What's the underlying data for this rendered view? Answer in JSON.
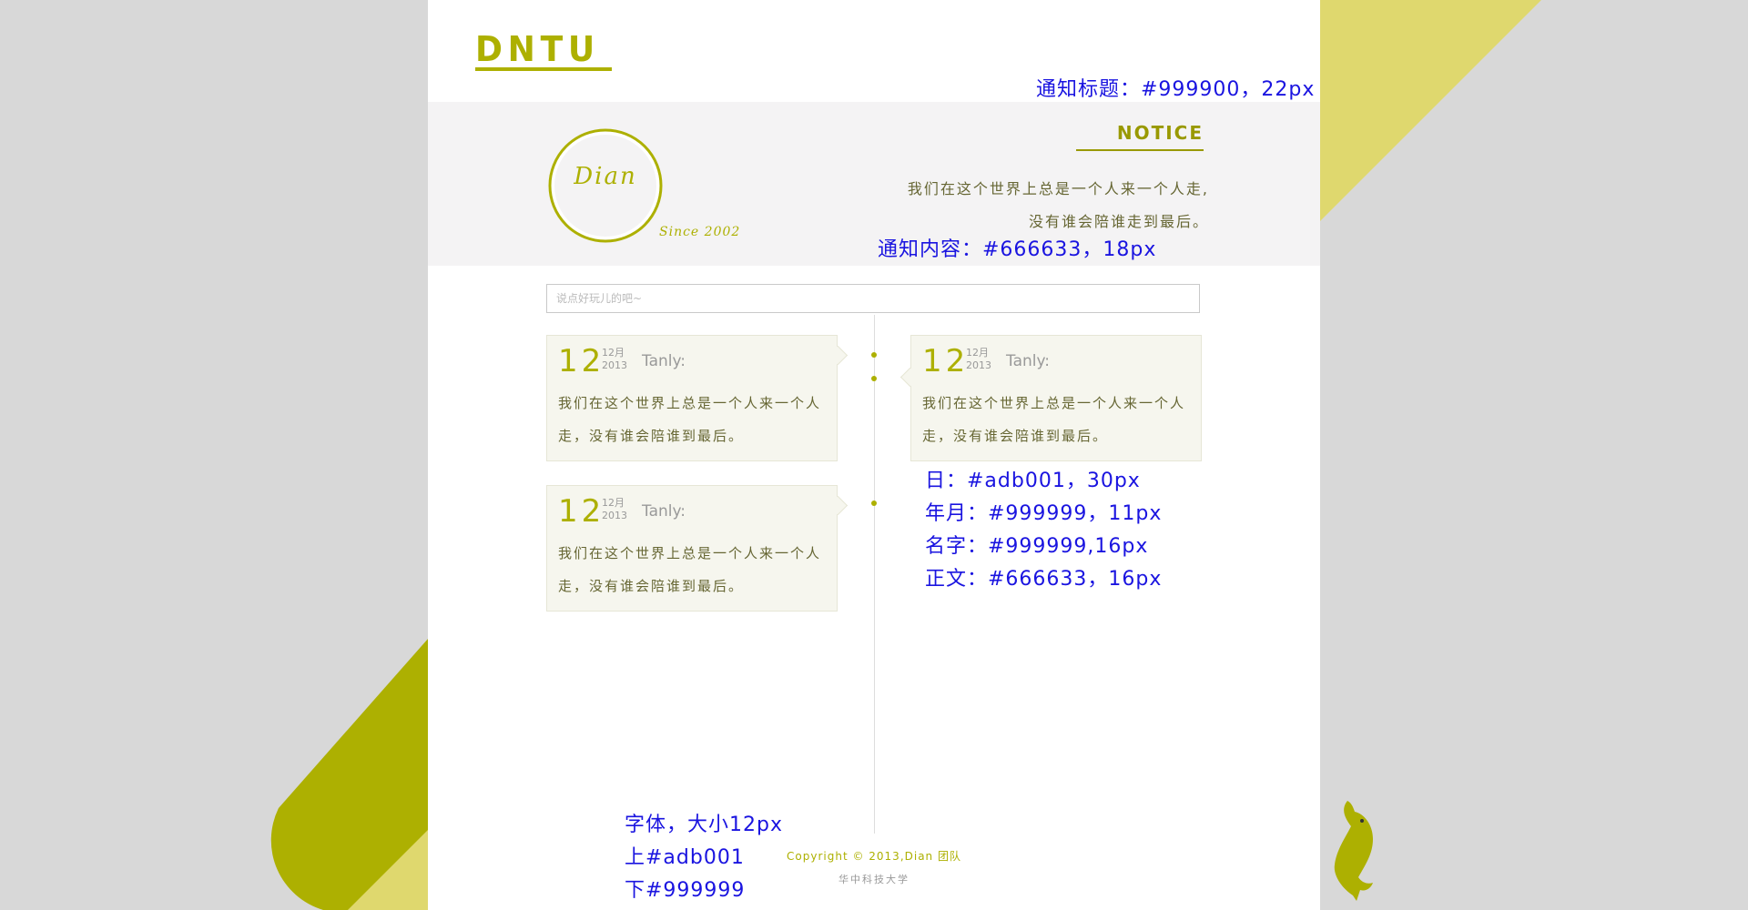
{
  "colors": {
    "accent": "#adb001",
    "accent_light": "#dfd86e",
    "title": "#999900",
    "content": "#666633",
    "muted": "#999999",
    "annotation": "#1a14e0"
  },
  "header": {
    "logo_text": "DNTU"
  },
  "notice": {
    "brand": "Dian",
    "since": "Since 2002",
    "title": "NOTICE",
    "lines": [
      "我们在这个世界上总是一个人来一个人走,",
      "没有谁会陪谁走到最后。"
    ]
  },
  "input": {
    "placeholder": "说点好玩儿的吧~"
  },
  "posts": [
    {
      "day": "12",
      "month": "12月",
      "year": "2013",
      "name": "Tanly:",
      "text": "我们在这个世界上总是一个人来一个人走，没有谁会陪谁到最后。"
    },
    {
      "day": "12",
      "month": "12月",
      "year": "2013",
      "name": "Tanly:",
      "text": "我们在这个世界上总是一个人来一个人走，没有谁会陪谁到最后。"
    },
    {
      "day": "12",
      "month": "12月",
      "year": "2013",
      "name": "Tanly:",
      "text": "我们在这个世界上总是一个人来一个人走，没有谁会陪谁到最后。"
    }
  ],
  "footer": {
    "copyright": "Copyright © 2013,Dian 团队",
    "school": "华中科技大学"
  },
  "annotations": {
    "notice_title": "通知标题：#999900，22px",
    "notice_content": "通知内容：#666633，18px",
    "day": "日：#adb001，30px",
    "ym": "年月：#999999，11px",
    "name": "名字：#999999,16px",
    "body": "正文：#666633，16px",
    "font": "字体，大小12px",
    "top": "上#adb001",
    "bottom": "下#999999"
  }
}
